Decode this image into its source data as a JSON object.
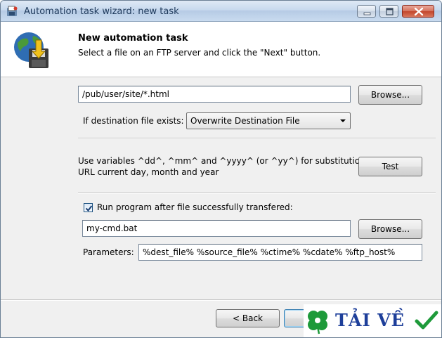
{
  "window": {
    "title": "Automation task wizard: new task",
    "minimize_icon": "minimize-icon",
    "maximize_icon": "maximize-icon",
    "close_icon": "close-icon"
  },
  "header": {
    "title": "New automation task",
    "subtitle": "Select a file on an FTP server and click the \"Next\" button.",
    "icon": "ftp-download-globe-icon"
  },
  "source": {
    "path_value": "/pub/user/site/*.html",
    "browse_label": "Browse..."
  },
  "destination": {
    "label": "If destination file exists:",
    "selected_option": "Overwrite Destination File"
  },
  "variables": {
    "description_line1": "Use variables ^dd^, ^mm^ and ^yyyy^ (or ^yy^) for substitution in",
    "description_line2": "URL current day, month and year",
    "test_label": "Test"
  },
  "run_program": {
    "checkbox_label": "Run program after file successfully transfered:",
    "checked": true,
    "program_value": "my-cmd.bat",
    "browse_label": "Browse...",
    "parameters_label": "Parameters:",
    "parameters_value": "%dest_file% %source_file% %ctime% %cdate% %ftp_host%"
  },
  "footer": {
    "back_label": "< Back"
  },
  "watermark": {
    "text": "TẢI VỀ",
    "clover_icon": "clover-icon",
    "check_icon": "checkmark-icon"
  },
  "colors": {
    "title_text": "#1e395b",
    "watermark_blue": "#1e3f9a",
    "watermark_green": "#1e9a3a"
  }
}
